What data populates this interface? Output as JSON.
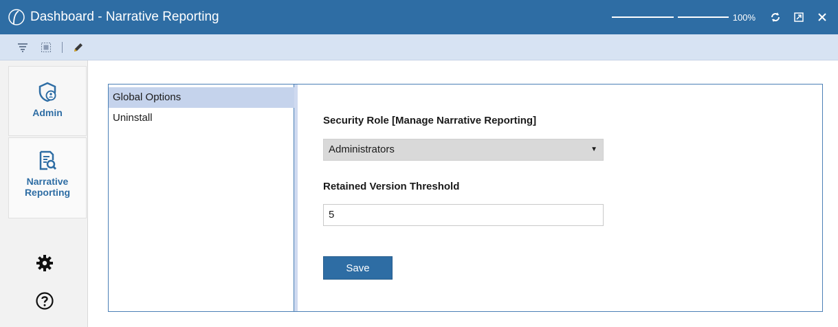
{
  "window": {
    "title": "Dashboard - Narrative Reporting",
    "zoom_label": "100%",
    "zoom_level_percent": 100,
    "icons": [
      "app-logo-icon",
      "refresh-icon",
      "popout-icon",
      "close-icon"
    ]
  },
  "toolbar": {
    "icons": [
      "filter-icon",
      "select-frame-icon",
      "pencil-icon"
    ]
  },
  "leftnav": {
    "items": [
      {
        "label": "Admin",
        "icon": "admin-shield-icon"
      },
      {
        "label": "Narrative Reporting",
        "icon": "report-search-icon"
      }
    ],
    "bottom_icons": [
      "gear-icon",
      "help-icon"
    ]
  },
  "options": {
    "items": [
      {
        "label": "Global Options",
        "selected": true
      },
      {
        "label": "Uninstall",
        "selected": false
      }
    ]
  },
  "form": {
    "security_role_label": "Security Role [Manage Narrative Reporting]",
    "security_role_value": "Administrators",
    "threshold_label": "Retained Version Threshold",
    "threshold_value": "5",
    "save_label": "Save"
  },
  "colors": {
    "title_bar": "#2e6da4",
    "toolbar": "#d7e3f3",
    "accent": "#2e6da4",
    "selected_item": "#c5d3ec"
  }
}
